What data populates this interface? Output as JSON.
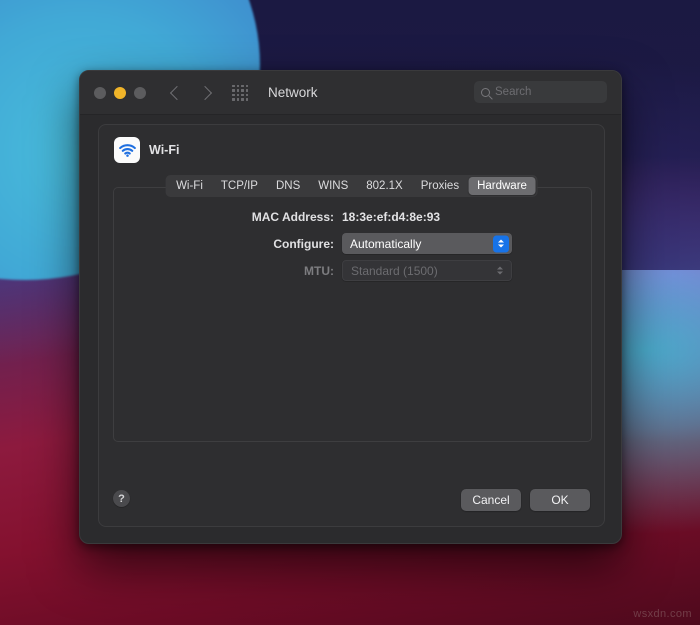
{
  "desktop": {
    "watermark": "wsxdn.com",
    "colors": {
      "navy": "#1d1a45",
      "cyan": "#49bddc",
      "purple": "#b25ceb",
      "red": "#d6242c",
      "crimson": "#4e0a1d"
    }
  },
  "window": {
    "title": "Network",
    "traffic_lights": {
      "close": "close-button",
      "minimize": "minimize-button",
      "zoom": "zoom-button"
    },
    "nav": {
      "back": "back-arrow",
      "forward": "forward-arrow",
      "show_all": "grid-icon"
    },
    "search": {
      "placeholder": "Search",
      "value": "",
      "icon": "search-icon"
    }
  },
  "sheet": {
    "service": {
      "name": "Wi-Fi",
      "icon": "wifi-icon"
    },
    "tabs": [
      {
        "label": "Wi-Fi",
        "selected": false
      },
      {
        "label": "TCP/IP",
        "selected": false
      },
      {
        "label": "DNS",
        "selected": false
      },
      {
        "label": "WINS",
        "selected": false
      },
      {
        "label": "802.1X",
        "selected": false
      },
      {
        "label": "Proxies",
        "selected": false
      },
      {
        "label": "Hardware",
        "selected": true
      }
    ],
    "form": {
      "mac_address": {
        "label": "MAC Address:",
        "value": "18:3e:ef:d4:8e:93"
      },
      "configure": {
        "label": "Configure:",
        "value": "Automatically",
        "enabled": true
      },
      "mtu": {
        "label": "MTU:",
        "value": "Standard  (1500)",
        "enabled": false
      }
    },
    "footer": {
      "help": "?",
      "cancel_label": "Cancel",
      "ok_label": "OK"
    }
  }
}
